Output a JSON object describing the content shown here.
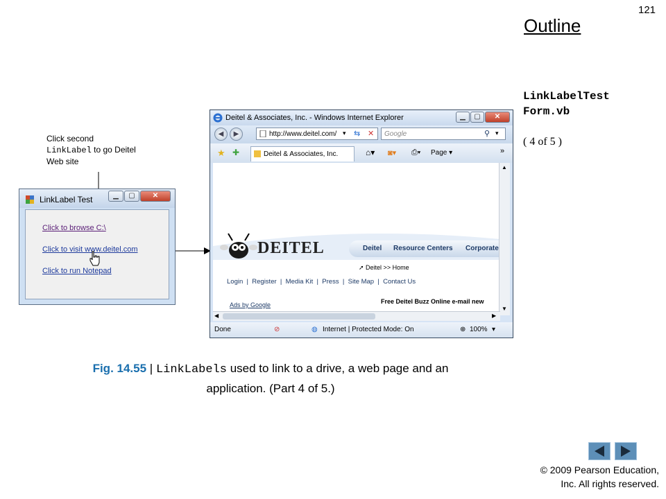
{
  "slide": {
    "page_number": "121",
    "outline_label": "Outline",
    "file_title_line1": "LinkLabelTest",
    "file_title_line2": "Form.vb",
    "part": "( 4 of 5 )"
  },
  "callout": {
    "line1": "Click second",
    "line2_code": "LinkLabel",
    "line2_rest": " to go Deitel",
    "line3": "Web site"
  },
  "form_window": {
    "title": "LinkLabel Test",
    "links": [
      "Click to browse C:\\",
      "Click to visit www.deitel.com",
      "Click to run Notepad"
    ],
    "link_colors": [
      "#5a1e77",
      "#1d3a9c",
      "#1d3a9c"
    ]
  },
  "browser": {
    "title": "Deitel & Associates, Inc. - Windows Internet Explorer",
    "address": "http://www.deitel.com/",
    "search_placeholder": "Google",
    "tab_label": "Deitel & Associates, Inc.",
    "page_menu": "Page",
    "site": {
      "logo": "DEITEL",
      "nav": [
        "Deitel",
        "Resource Centers",
        "Corporate"
      ],
      "breadcrumb": "Deitel >> Home",
      "menu": "Login  |  Register  |  Media Kit  |  Press  |  Site Map  |  Contact Us",
      "ads": "Ads by Google",
      "promo": "Free Deitel Buzz Online e-mail new"
    },
    "status": {
      "done": "Done",
      "zone": "Internet | Protected Mode: On",
      "zoom": "100%"
    }
  },
  "caption": {
    "fig": "Fig. 14.55",
    "sep": " | ",
    "code": "LinkLabels",
    "text1": " used to link to a drive, a web page and an",
    "text2": "application. (Part 4 of 5.)"
  },
  "footer": {
    "copyright_line1": "© 2009 Pearson Education,",
    "copyright_line2": "Inc.  All rights reserved."
  }
}
